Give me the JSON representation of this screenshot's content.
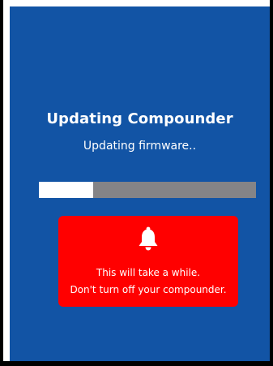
{
  "dialog": {
    "title": "Updating Compounder",
    "status": "Updating firmware..",
    "progress_fraction": 0.25,
    "warning": {
      "icon": "bell-icon",
      "line1": "This will take a while.",
      "line2": "Don't turn off your compounder."
    }
  },
  "colors": {
    "background": "#1254a5",
    "progress_track": "#848487",
    "progress_fill": "#ffffff",
    "warning_bg": "#ff0000",
    "text": "#ffffff"
  }
}
